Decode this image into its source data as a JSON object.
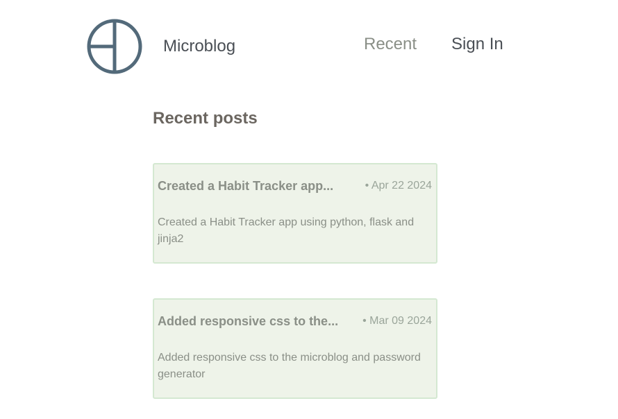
{
  "header": {
    "brand": "Microblog",
    "logo_icon": "circle-split-logo-icon",
    "nav": [
      {
        "label": "Recent"
      },
      {
        "label": "Sign In"
      }
    ]
  },
  "main": {
    "section_title": "Recent posts",
    "posts": [
      {
        "title": "Created a Habit Tracker app...",
        "date": "• Apr 22 2024",
        "body": "Created a Habit Tracker app using python, flask and jinja2"
      },
      {
        "title": "Added responsive css to the...",
        "date": "• Mar 09 2024",
        "body": "Added responsive css to the microblog and password generator"
      }
    ]
  },
  "colors": {
    "logo": "#536a7a",
    "card_bg": "#eef3e9",
    "card_border": "#d4e8d1",
    "text_muted": "#8a8f87",
    "text_dark": "#4a4f55"
  }
}
